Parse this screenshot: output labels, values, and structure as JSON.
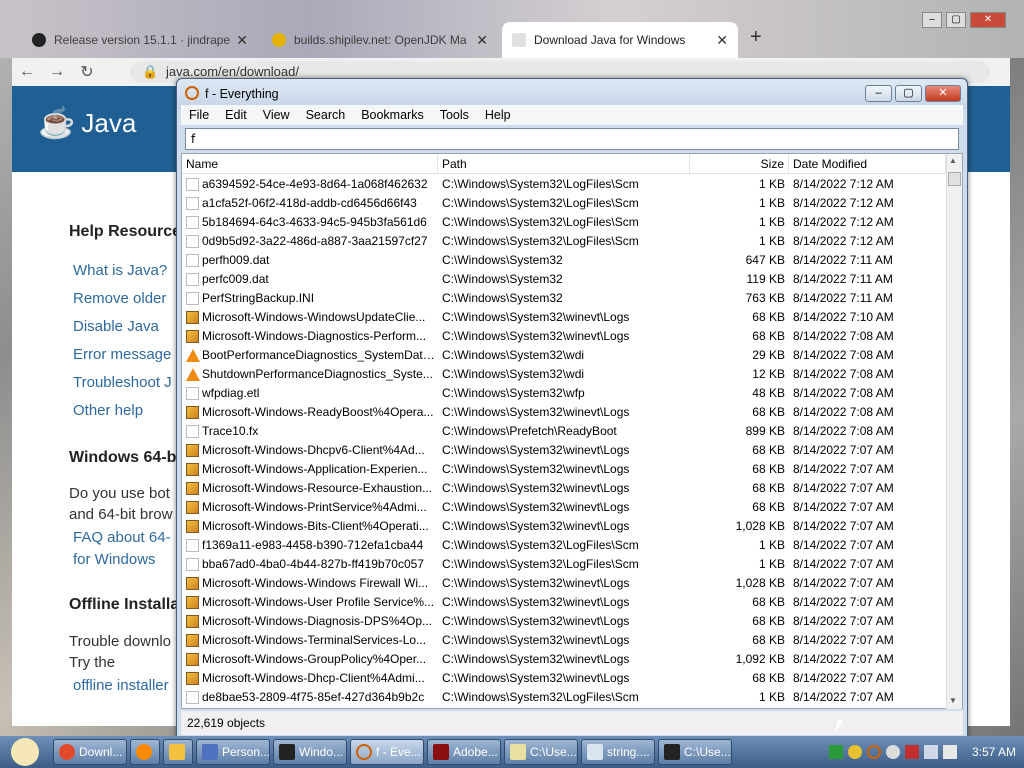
{
  "browser": {
    "tabs": [
      {
        "label": "Release version 15.1.1 · jindrape"
      },
      {
        "label": "builds.shipilev.net: OpenJDK Ma"
      },
      {
        "label": "Download Java for Windows"
      }
    ],
    "url": "java.com/en/download/"
  },
  "java_page": {
    "logo_text": "Java",
    "help_heading": "Help Resource",
    "help_links": [
      "What is Java?",
      "Remove older",
      "Disable Java",
      "Error message",
      "Troubleshoot J",
      "Other help"
    ],
    "win64_heading": "Windows 64-b",
    "win64_text": [
      "Do you use bot",
      "and 64-bit brow"
    ],
    "faq_link": [
      "FAQ about 64-",
      "for Windows"
    ],
    "offline_heading": "Offline Installa",
    "offline_text": [
      "Trouble downlo",
      "Try the"
    ],
    "offline_link": "offline installer"
  },
  "everything": {
    "title": "f - Everything",
    "menu": [
      "File",
      "Edit",
      "View",
      "Search",
      "Bookmarks",
      "Tools",
      "Help"
    ],
    "search_value": "f",
    "columns": {
      "name": "Name",
      "path": "Path",
      "size": "Size",
      "date": "Date Modified"
    },
    "rows": [
      {
        "icon": "file",
        "name": "a6394592-54ce-4e93-8d64-1a068f462632",
        "path": "C:\\Windows\\System32\\LogFiles\\Scm",
        "size": "1 KB",
        "date": "8/14/2022 7:12 AM"
      },
      {
        "icon": "file",
        "name": "a1cfa52f-06f2-418d-addb-cd6456d66f43",
        "path": "C:\\Windows\\System32\\LogFiles\\Scm",
        "size": "1 KB",
        "date": "8/14/2022 7:12 AM"
      },
      {
        "icon": "file",
        "name": "5b184694-64c3-4633-94c5-945b3fa561d6",
        "path": "C:\\Windows\\System32\\LogFiles\\Scm",
        "size": "1 KB",
        "date": "8/14/2022 7:12 AM"
      },
      {
        "icon": "file",
        "name": "0d9b5d92-3a22-486d-a887-3aa21597cf27",
        "path": "C:\\Windows\\System32\\LogFiles\\Scm",
        "size": "1 KB",
        "date": "8/14/2022 7:12 AM"
      },
      {
        "icon": "file",
        "name": "perfh009.dat",
        "path": "C:\\Windows\\System32",
        "size": "647 KB",
        "date": "8/14/2022 7:11 AM"
      },
      {
        "icon": "file",
        "name": "perfc009.dat",
        "path": "C:\\Windows\\System32",
        "size": "119 KB",
        "date": "8/14/2022 7:11 AM"
      },
      {
        "icon": "file",
        "name": "PerfStringBackup.INI",
        "path": "C:\\Windows\\System32",
        "size": "763 KB",
        "date": "8/14/2022 7:11 AM"
      },
      {
        "icon": "evt",
        "name": "Microsoft-Windows-WindowsUpdateClie...",
        "path": "C:\\Windows\\System32\\winevt\\Logs",
        "size": "68 KB",
        "date": "8/14/2022 7:10 AM"
      },
      {
        "icon": "evt",
        "name": "Microsoft-Windows-Diagnostics-Perform...",
        "path": "C:\\Windows\\System32\\winevt\\Logs",
        "size": "68 KB",
        "date": "8/14/2022 7:08 AM"
      },
      {
        "icon": "warn",
        "name": "BootPerformanceDiagnostics_SystemData...",
        "path": "C:\\Windows\\System32\\wdi",
        "size": "29 KB",
        "date": "8/14/2022 7:08 AM"
      },
      {
        "icon": "warn",
        "name": "ShutdownPerformanceDiagnostics_Syste...",
        "path": "C:\\Windows\\System32\\wdi",
        "size": "12 KB",
        "date": "8/14/2022 7:08 AM"
      },
      {
        "icon": "file",
        "name": "wfpdiag.etl",
        "path": "C:\\Windows\\System32\\wfp",
        "size": "48 KB",
        "date": "8/14/2022 7:08 AM"
      },
      {
        "icon": "evt",
        "name": "Microsoft-Windows-ReadyBoost%4Opera...",
        "path": "C:\\Windows\\System32\\winevt\\Logs",
        "size": "68 KB",
        "date": "8/14/2022 7:08 AM"
      },
      {
        "icon": "file",
        "name": "Trace10.fx",
        "path": "C:\\Windows\\Prefetch\\ReadyBoot",
        "size": "899 KB",
        "date": "8/14/2022 7:08 AM"
      },
      {
        "icon": "evt",
        "name": "Microsoft-Windows-Dhcpv6-Client%4Ad...",
        "path": "C:\\Windows\\System32\\winevt\\Logs",
        "size": "68 KB",
        "date": "8/14/2022 7:07 AM"
      },
      {
        "icon": "evt",
        "name": "Microsoft-Windows-Application-Experien...",
        "path": "C:\\Windows\\System32\\winevt\\Logs",
        "size": "68 KB",
        "date": "8/14/2022 7:07 AM"
      },
      {
        "icon": "evt",
        "name": "Microsoft-Windows-Resource-Exhaustion...",
        "path": "C:\\Windows\\System32\\winevt\\Logs",
        "size": "68 KB",
        "date": "8/14/2022 7:07 AM"
      },
      {
        "icon": "evt",
        "name": "Microsoft-Windows-PrintService%4Admi...",
        "path": "C:\\Windows\\System32\\winevt\\Logs",
        "size": "68 KB",
        "date": "8/14/2022 7:07 AM"
      },
      {
        "icon": "evt",
        "name": "Microsoft-Windows-Bits-Client%4Operati...",
        "path": "C:\\Windows\\System32\\winevt\\Logs",
        "size": "1,028 KB",
        "date": "8/14/2022 7:07 AM"
      },
      {
        "icon": "file",
        "name": "f1369a11-e983-4458-b390-712efa1cba44",
        "path": "C:\\Windows\\System32\\LogFiles\\Scm",
        "size": "1 KB",
        "date": "8/14/2022 7:07 AM"
      },
      {
        "icon": "file",
        "name": "bba67ad0-4ba0-4b44-827b-ff419b70c057",
        "path": "C:\\Windows\\System32\\LogFiles\\Scm",
        "size": "1 KB",
        "date": "8/14/2022 7:07 AM"
      },
      {
        "icon": "evt",
        "name": "Microsoft-Windows-Windows Firewall Wi...",
        "path": "C:\\Windows\\System32\\winevt\\Logs",
        "size": "1,028 KB",
        "date": "8/14/2022 7:07 AM"
      },
      {
        "icon": "evt",
        "name": "Microsoft-Windows-User Profile Service%...",
        "path": "C:\\Windows\\System32\\winevt\\Logs",
        "size": "68 KB",
        "date": "8/14/2022 7:07 AM"
      },
      {
        "icon": "evt",
        "name": "Microsoft-Windows-Diagnosis-DPS%4Op...",
        "path": "C:\\Windows\\System32\\winevt\\Logs",
        "size": "68 KB",
        "date": "8/14/2022 7:07 AM"
      },
      {
        "icon": "evt",
        "name": "Microsoft-Windows-TerminalServices-Lo...",
        "path": "C:\\Windows\\System32\\winevt\\Logs",
        "size": "68 KB",
        "date": "8/14/2022 7:07 AM"
      },
      {
        "icon": "evt",
        "name": "Microsoft-Windows-GroupPolicy%4Oper...",
        "path": "C:\\Windows\\System32\\winevt\\Logs",
        "size": "1,092 KB",
        "date": "8/14/2022 7:07 AM"
      },
      {
        "icon": "evt",
        "name": "Microsoft-Windows-Dhcp-Client%4Admi...",
        "path": "C:\\Windows\\System32\\winevt\\Logs",
        "size": "68 KB",
        "date": "8/14/2022 7:07 AM"
      },
      {
        "icon": "file",
        "name": "de8bae53-2809-4f75-85ef-427d364b9b2c",
        "path": "C:\\Windows\\System32\\LogFiles\\Scm",
        "size": "1 KB",
        "date": "8/14/2022 7:07 AM"
      }
    ],
    "status": "22,619 objects"
  },
  "taskbar": {
    "items": [
      "Downl...",
      "Person...",
      "Windo...",
      "f - Eve...",
      "Adobe...",
      "C:\\Use...",
      "string....",
      "C:\\Use..."
    ],
    "clock": "3:57 AM"
  }
}
